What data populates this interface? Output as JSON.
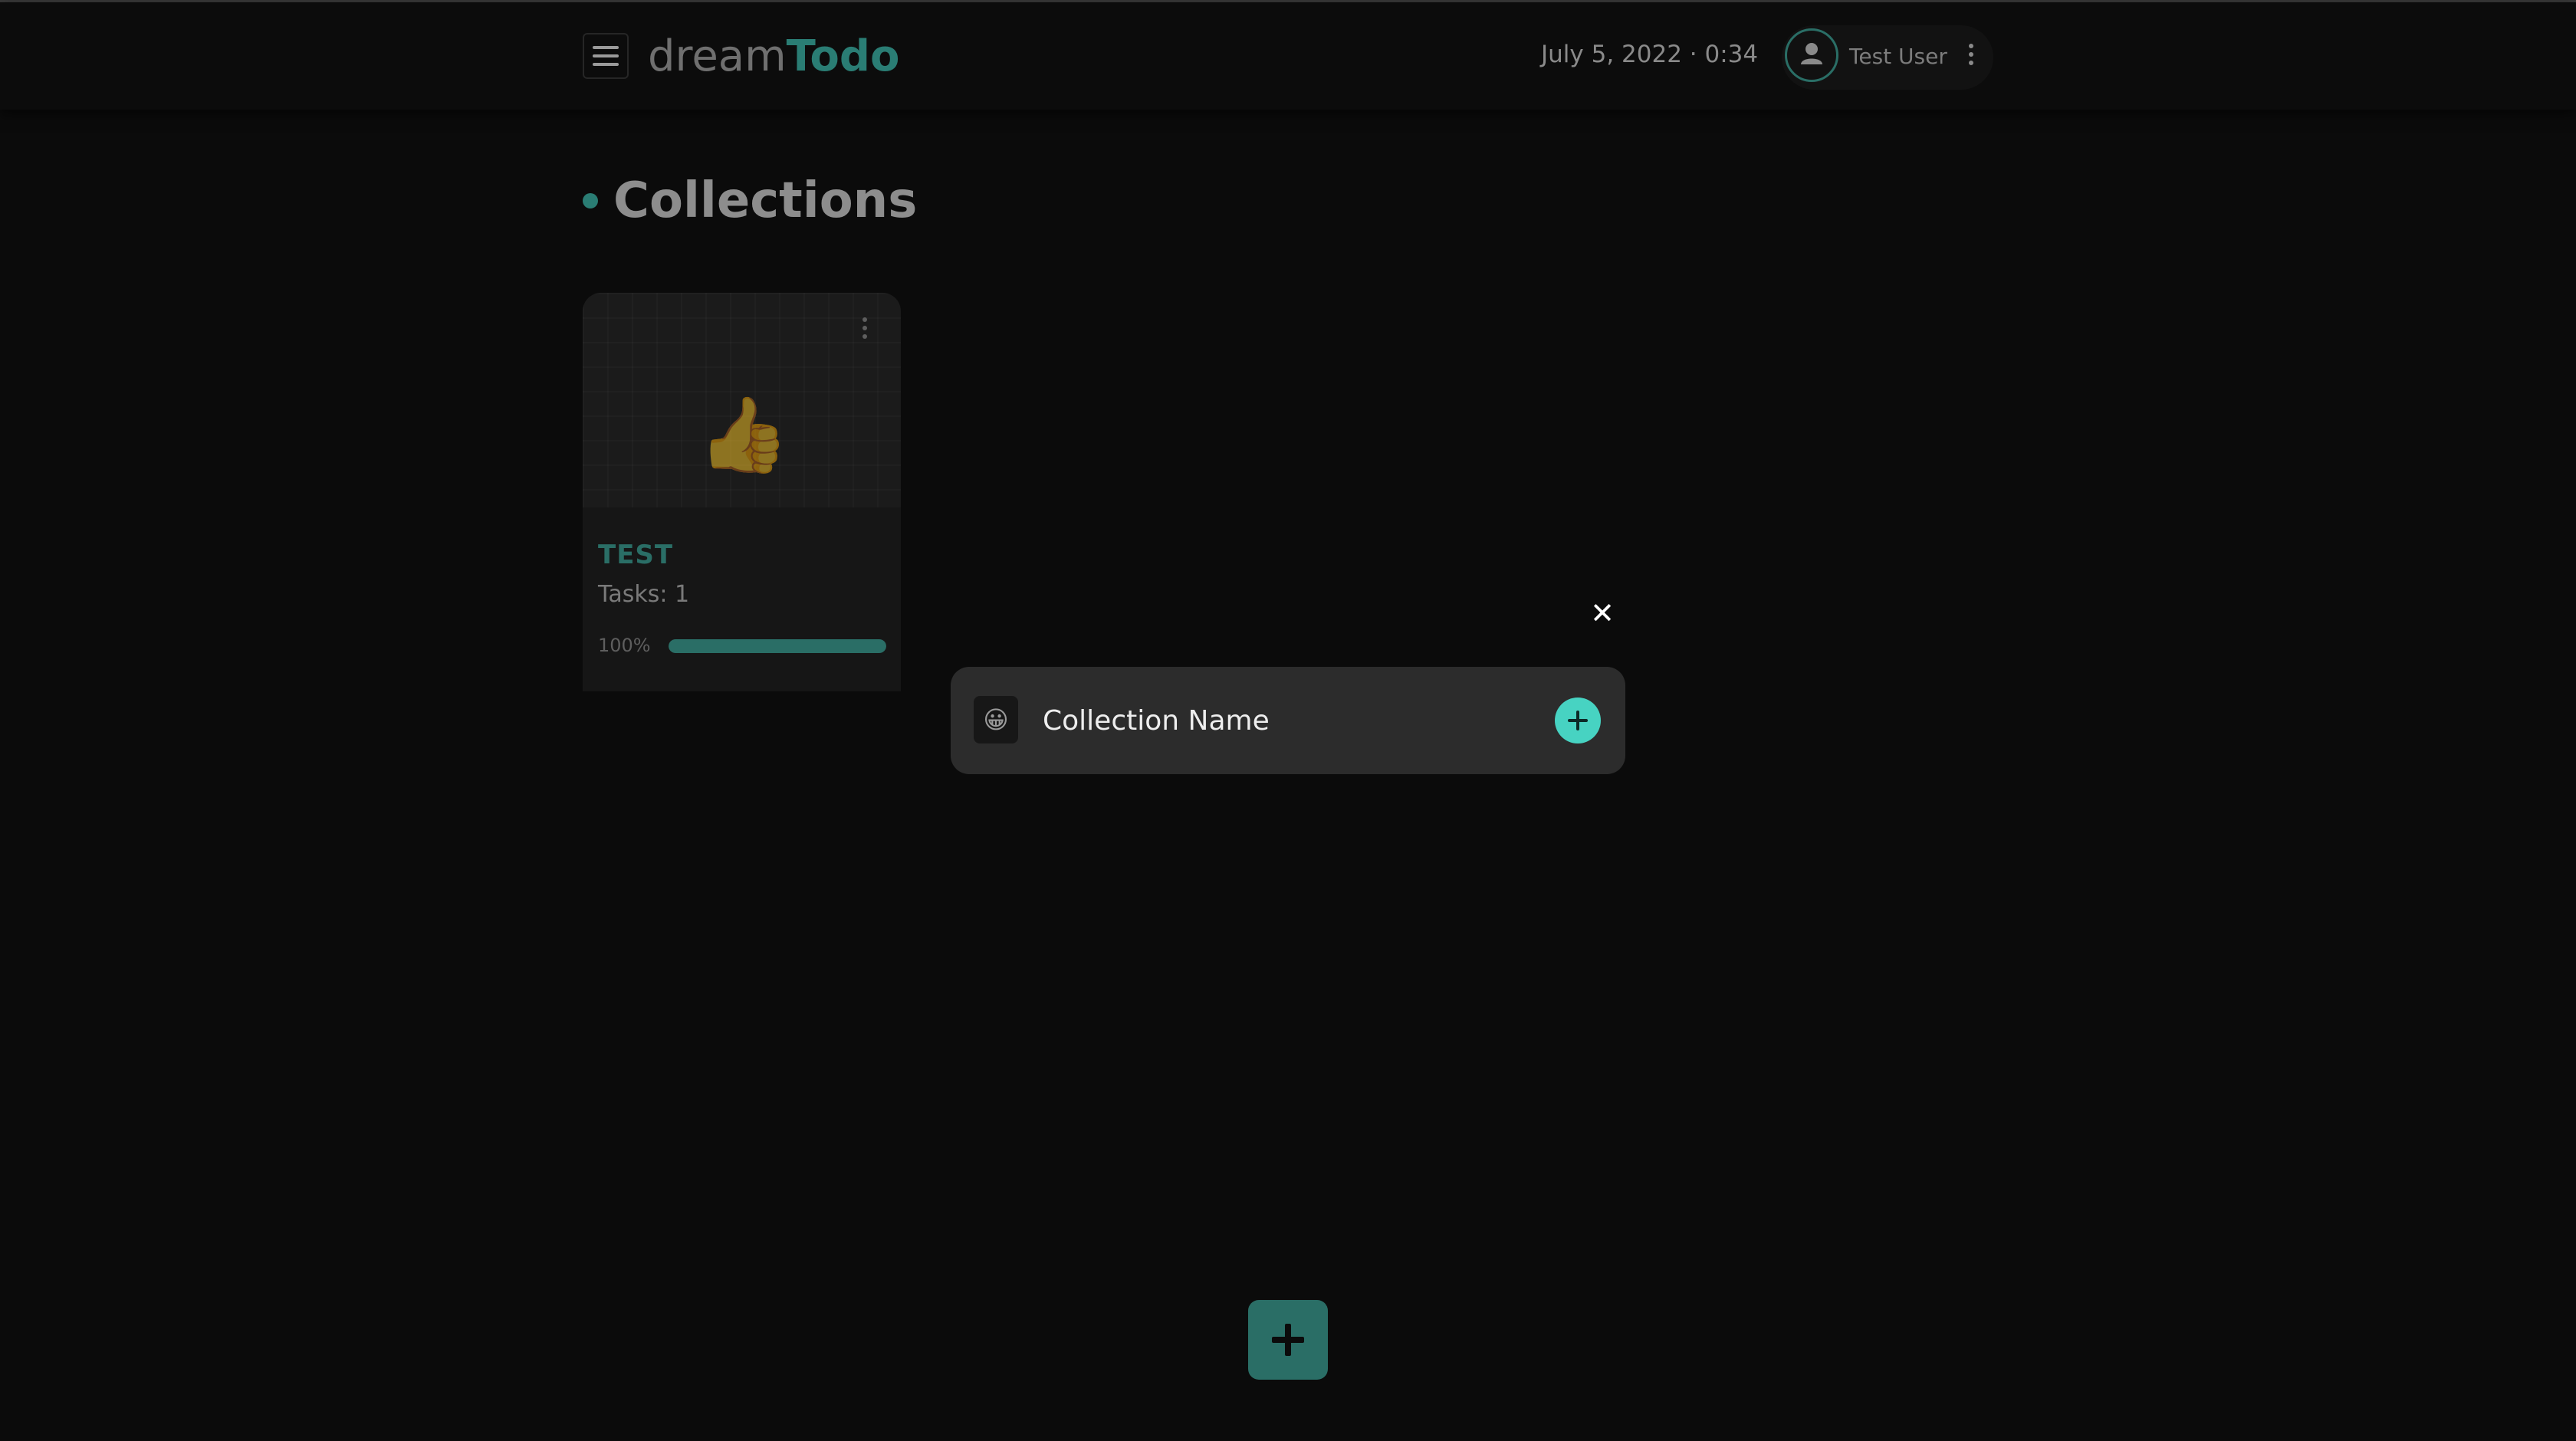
{
  "header": {
    "logo_light": "dream",
    "logo_bold": "Todo",
    "datetime": "July 5, 2022 · 0:34",
    "user_name": "Test User",
    "menu_icon": "hamburger-icon",
    "avatar_icon": "user-icon",
    "more_icon": "more-vertical-icon"
  },
  "page": {
    "title": "Collections"
  },
  "collections": [
    {
      "emoji": "👍",
      "name": "TEST",
      "tasks_label": "Tasks: 1",
      "progress_label": "100%",
      "progress": 1.0
    }
  ],
  "dialog": {
    "close_icon": "close-icon",
    "emoji": "😀",
    "name_placeholder": "Collection Name",
    "add_icon": "plus-icon"
  },
  "fab": {
    "icon": "plus-icon"
  },
  "colors": {
    "accent": "#2a7d74",
    "accent_bright": "#47d3c2",
    "background": "#0b0b0b",
    "dialog": "#2c2c2c"
  }
}
